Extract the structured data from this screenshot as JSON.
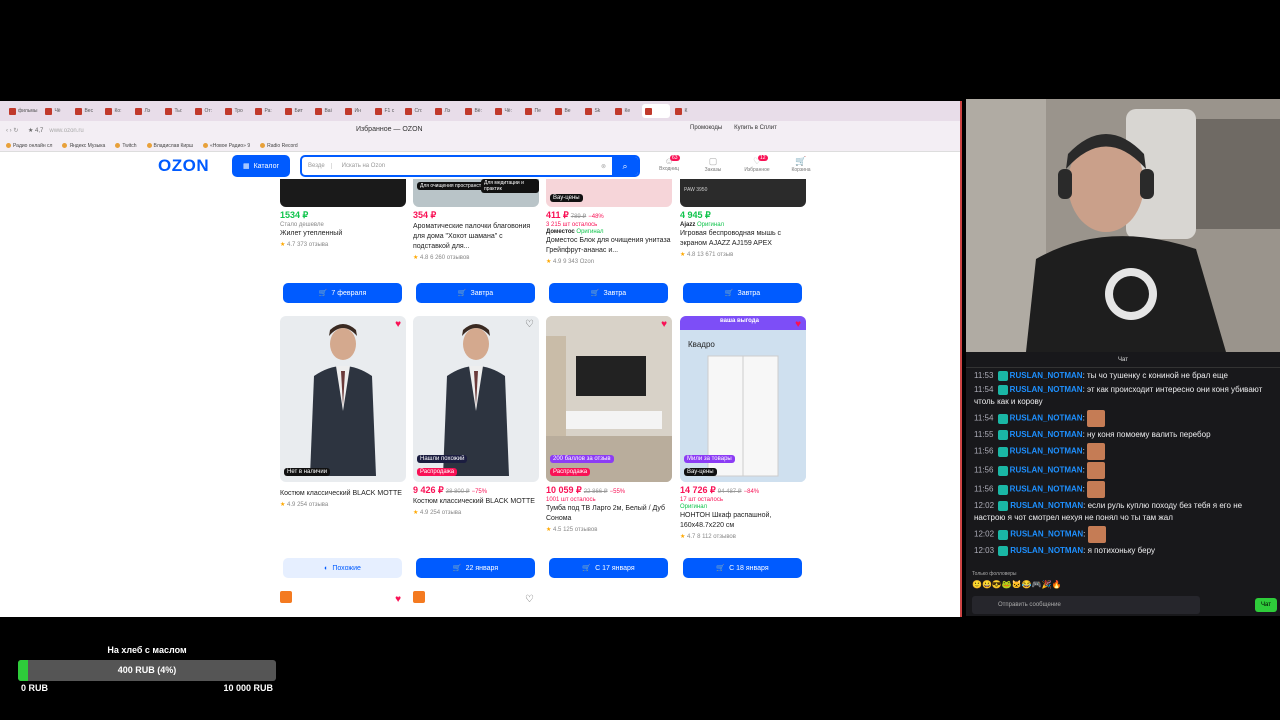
{
  "browser": {
    "tabs": [
      "фильмы",
      "Чё",
      "Вес",
      "Ко:",
      "Лэ",
      "Ты:",
      "От:",
      "Тро",
      "Ра:",
      "Бит",
      "Ваі",
      "Ин",
      "F1 c",
      "Сп:",
      "Лэ",
      "Вё:",
      "Чё:",
      "Пе",
      "Ве",
      "Sk",
      "Ке",
      "",
      "К"
    ],
    "rating": "★ 4,7",
    "url": "www.ozon.ru",
    "page_title": "Избранное — OZON",
    "promo": "Промокоды",
    "split": "Купить в Сплит",
    "bookmarks": [
      "Радио онлайн сл",
      "Яндекс Музыка",
      "Twitch",
      "Владислав Кирш",
      "«Новое Радио» 9",
      "Radio Record"
    ]
  },
  "ozon": {
    "logo": "OZON",
    "catalog": "Каталог",
    "search_scope": "Везде",
    "search_placeholder": "Искать на Ozon",
    "icons": [
      {
        "label": "Входниц",
        "badge": "63"
      },
      {
        "label": "Заказы",
        "badge": ""
      },
      {
        "label": "Избранное",
        "badge": "12"
      },
      {
        "label": "Корзина",
        "badge": ""
      }
    ]
  },
  "row1": [
    {
      "img_text": "",
      "price": "1534 ₽",
      "old": "",
      "disc": "",
      "note": "Стало дешевле",
      "brand": "",
      "orig": "",
      "title": "Жилет утепленный",
      "rating": "4.7",
      "reviews": "373 отзыва",
      "button": "7 февраля"
    },
    {
      "img_text": "Для очищения пространства",
      "img_text2": "Для медитации и практик",
      "price": "354 ₽",
      "old": "",
      "disc": "",
      "note": "",
      "brand": "",
      "orig": "",
      "title": "Ароматические палочки благовония для дома \"Хохот шамана\" с подставкой для...",
      "rating": "4.8",
      "reviews": "6 260 отзывов",
      "button": "Завтра"
    },
    {
      "img_text": "Вау-цены",
      "price": "411 ₽",
      "old": "789 ₽",
      "disc": "−48%",
      "note": "3 215 шт осталось",
      "brand": "Доместос",
      "orig": "Оригинал",
      "title": "Доместос Блок для очищения унитаза Грейпфрут-ананас и...",
      "rating": "4.9",
      "reviews": "9 343",
      "seller": "Ozon",
      "button": "Завтра"
    },
    {
      "img_text": "PAW 3950",
      "price": "4 945 ₽",
      "old": "",
      "disc": "",
      "note": "",
      "brand": "Ajazz",
      "orig": "Оригинал",
      "title": "Игровая беспроводная мышь с экраном AJAZZ AJ159 APEX",
      "rating": "4.8",
      "reviews": "13 671 отзыв",
      "button": "Завтра"
    }
  ],
  "row2": [
    {
      "tag1": "Нет в наличии",
      "tag2": "",
      "price": "",
      "old": "",
      "disc": "",
      "note": "",
      "title": "Костюм классический BLACK MOTTE",
      "rating": "4.9",
      "reviews": "254 отзыва",
      "button": "Похожие"
    },
    {
      "tag1": "Нашли похожий",
      "tag2": "Распродажа",
      "price": "9 426 ₽",
      "old": "38 800 ₽",
      "disc": "−75%",
      "note": "",
      "title": "Костюм классический BLACK MOTTE",
      "rating": "4.9",
      "reviews": "254 отзыва",
      "button": "22 января"
    },
    {
      "tag1": "200 баллов за отзыв",
      "tag2": "Распродажа",
      "price": "10 059 ₽",
      "old": "22 866 ₽",
      "disc": "−55%",
      "note": "1001 шт осталось",
      "title": "Тумба под ТВ Ларго 2м, Белый / Дуб Сонома",
      "rating": "4.5",
      "reviews": "125 отзывов",
      "button": "С 17 января"
    },
    {
      "tag1": "Мили за товары",
      "tag2": "Вау-цены",
      "img_brand": "Квадро",
      "img_banner": "ваша выгода",
      "price": "14 726 ₽",
      "old": "94 487 ₽",
      "disc": "−84%",
      "note": "17 шт осталось",
      "brand": "",
      "orig": "Оригинал",
      "title": "НОНТОН Шкаф распашной, 160x48.7x220 см",
      "rating": "4.7",
      "reviews": "8 112 отзывов",
      "button": "С 18 января"
    }
  ],
  "chat": {
    "header": "Чат",
    "messages": [
      {
        "time": "11:53",
        "user": "RUSLAN_NOTMAN",
        "text": ": ты чо тушенку с кониной не брал еще",
        "emote": false
      },
      {
        "time": "11:54",
        "user": "RUSLAN_NOTMAN",
        "text": ": эт как происходит интересно они коня убивают чтоль как и корову",
        "emote": false
      },
      {
        "time": "11:54",
        "user": "RUSLAN_NOTMAN",
        "text": ":",
        "emote": true
      },
      {
        "time": "11:55",
        "user": "RUSLAN_NOTMAN",
        "text": ": ну коня помоему валить перебор",
        "emote": false
      },
      {
        "time": "11:56",
        "user": "RUSLAN_NOTMAN",
        "text": ":",
        "emote": true
      },
      {
        "time": "11:56",
        "user": "RUSLAN_NOTMAN",
        "text": ":",
        "emote": true
      },
      {
        "time": "11:56",
        "user": "RUSLAN_NOTMAN",
        "text": ":",
        "emote": true
      },
      {
        "time": "12:02",
        "user": "RUSLAN_NOTMAN",
        "text": ": если руль куплю походу без тебя я его не настрою я чот смотрел нехуя не понял чо ты там жал",
        "emote": false
      },
      {
        "time": "12:02",
        "user": "RUSLAN_NOTMAN",
        "text": ":",
        "emote": true
      },
      {
        "time": "12:03",
        "user": "RUSLAN_NOTMAN",
        "text": ": я потихоньку беру",
        "emote": false
      }
    ],
    "followers_only": "Только фолловеры",
    "input_placeholder": "Отправить сообщение",
    "send": "Чат"
  },
  "goal": {
    "title": "На хлеб с маслом",
    "progress_label": "400 RUB (4%)",
    "progress": 0.04,
    "min": "0 RUB",
    "max": "10 000 RUB"
  },
  "colors": {
    "ozon_blue": "#005bff",
    "ozon_pink": "#f91155",
    "ozon_green": "#10c44c",
    "twitch_chat_bg": "#18181b",
    "goal_green": "#2ecc3a"
  }
}
